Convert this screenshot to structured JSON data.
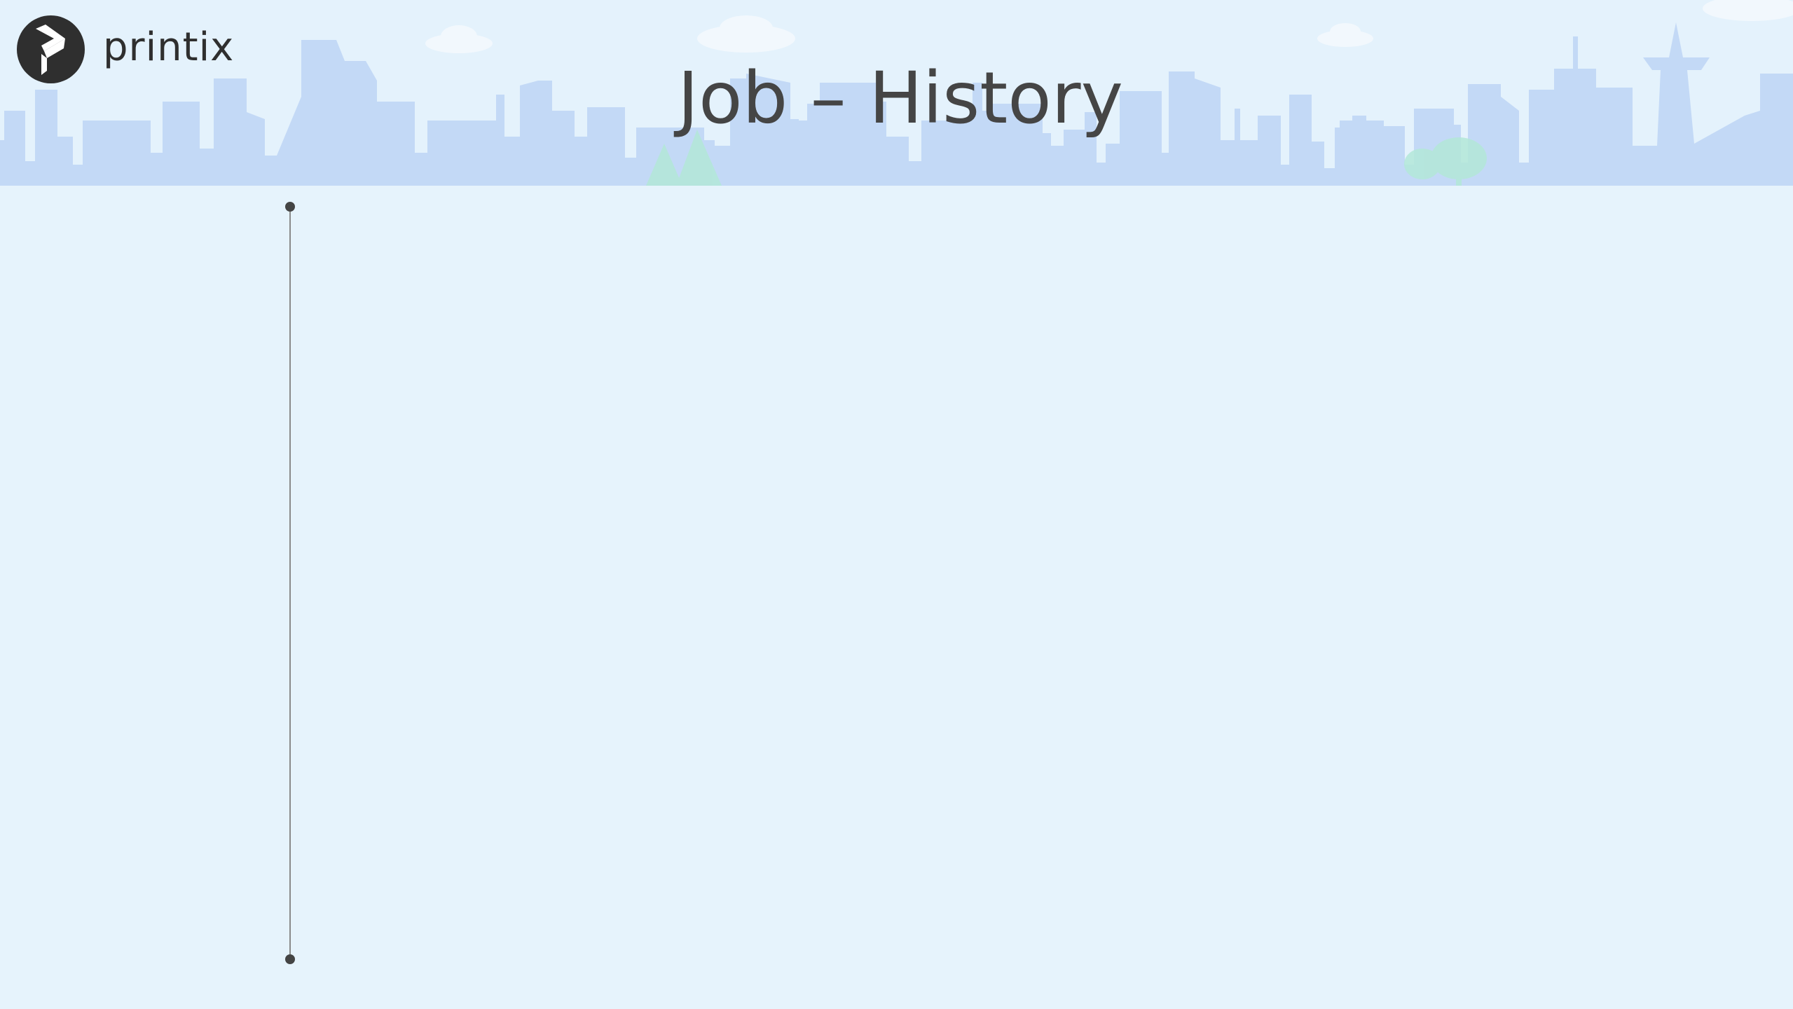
{
  "brand": {
    "name": "printix",
    "logo_icon": "printix-logo-icon"
  },
  "slide": {
    "title": "Job – History"
  },
  "colors": {
    "background": "#e6f3fc",
    "skyline": "#c3d9f6",
    "trees": "#b3e8d8",
    "title_text": "#454545",
    "timeline_line": "#8a8a8a"
  }
}
